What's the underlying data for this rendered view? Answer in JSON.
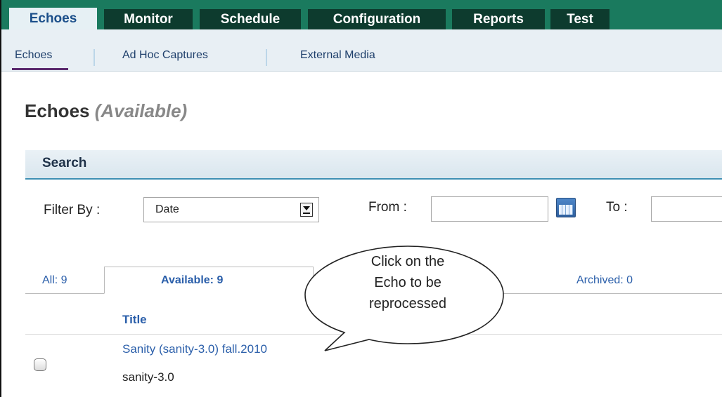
{
  "top_tabs": [
    "Echoes",
    "Monitor",
    "Schedule",
    "Configuration",
    "Reports",
    "Test"
  ],
  "sub_nav": [
    "Echoes",
    "Ad Hoc Captures",
    "External Media"
  ],
  "page": {
    "title": "Echoes",
    "title_qualifier": "(Available)"
  },
  "search": {
    "header": "Search",
    "filter_label": "Filter By :",
    "filter_value": "Date",
    "from_label": "From :",
    "from_value": "",
    "to_label": "To :",
    "to_value": ""
  },
  "status_tabs": [
    "All: 9",
    "Available: 9",
    "Archived: 0"
  ],
  "table": {
    "column_title": "Title",
    "rows": [
      {
        "title": "Sanity (sanity-3.0) fall.2010",
        "subtitle": "sanity-3.0"
      }
    ]
  },
  "callout": {
    "line1": "Click on the",
    "line2": "Echo to be",
    "line3": "reprocessed"
  },
  "colors": {
    "nav_green": "#1a7a5e",
    "tab_dark": "#0d3b2e",
    "link_blue": "#2b5faa",
    "accent_teal": "#3e8fb4"
  },
  "icons": {
    "calendar": "calendar-icon",
    "dropdown": "chevron-down-icon",
    "checkbox": "checkbox-icon"
  }
}
